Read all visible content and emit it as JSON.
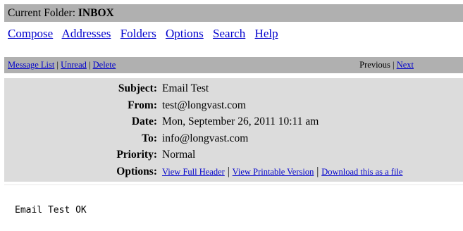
{
  "folder_bar": {
    "label": "Current Folder:",
    "folder": "INBOX"
  },
  "main_nav": [
    "Compose",
    "Addresses",
    "Folders",
    "Options",
    "Search",
    "Help"
  ],
  "message_bar": {
    "message_list": "Message List",
    "unread": "Unread",
    "delete": "Delete",
    "sep": "|",
    "previous": "Previous",
    "next": "Next"
  },
  "headers": {
    "subject_label": "Subject:",
    "subject": "Email Test",
    "from_label": "From:",
    "from": "test@longvast.com",
    "date_label": "Date:",
    "date": "Mon, September 26, 2011 10:11 am",
    "to_label": "To:",
    "to": "info@longvast.com",
    "priority_label": "Priority:",
    "priority": "Normal",
    "options_label": "Options:",
    "view_full_header": "View Full Header",
    "view_printable": "View Printable Version",
    "download": "Download this as a file"
  },
  "body_text": "Email Test OK"
}
